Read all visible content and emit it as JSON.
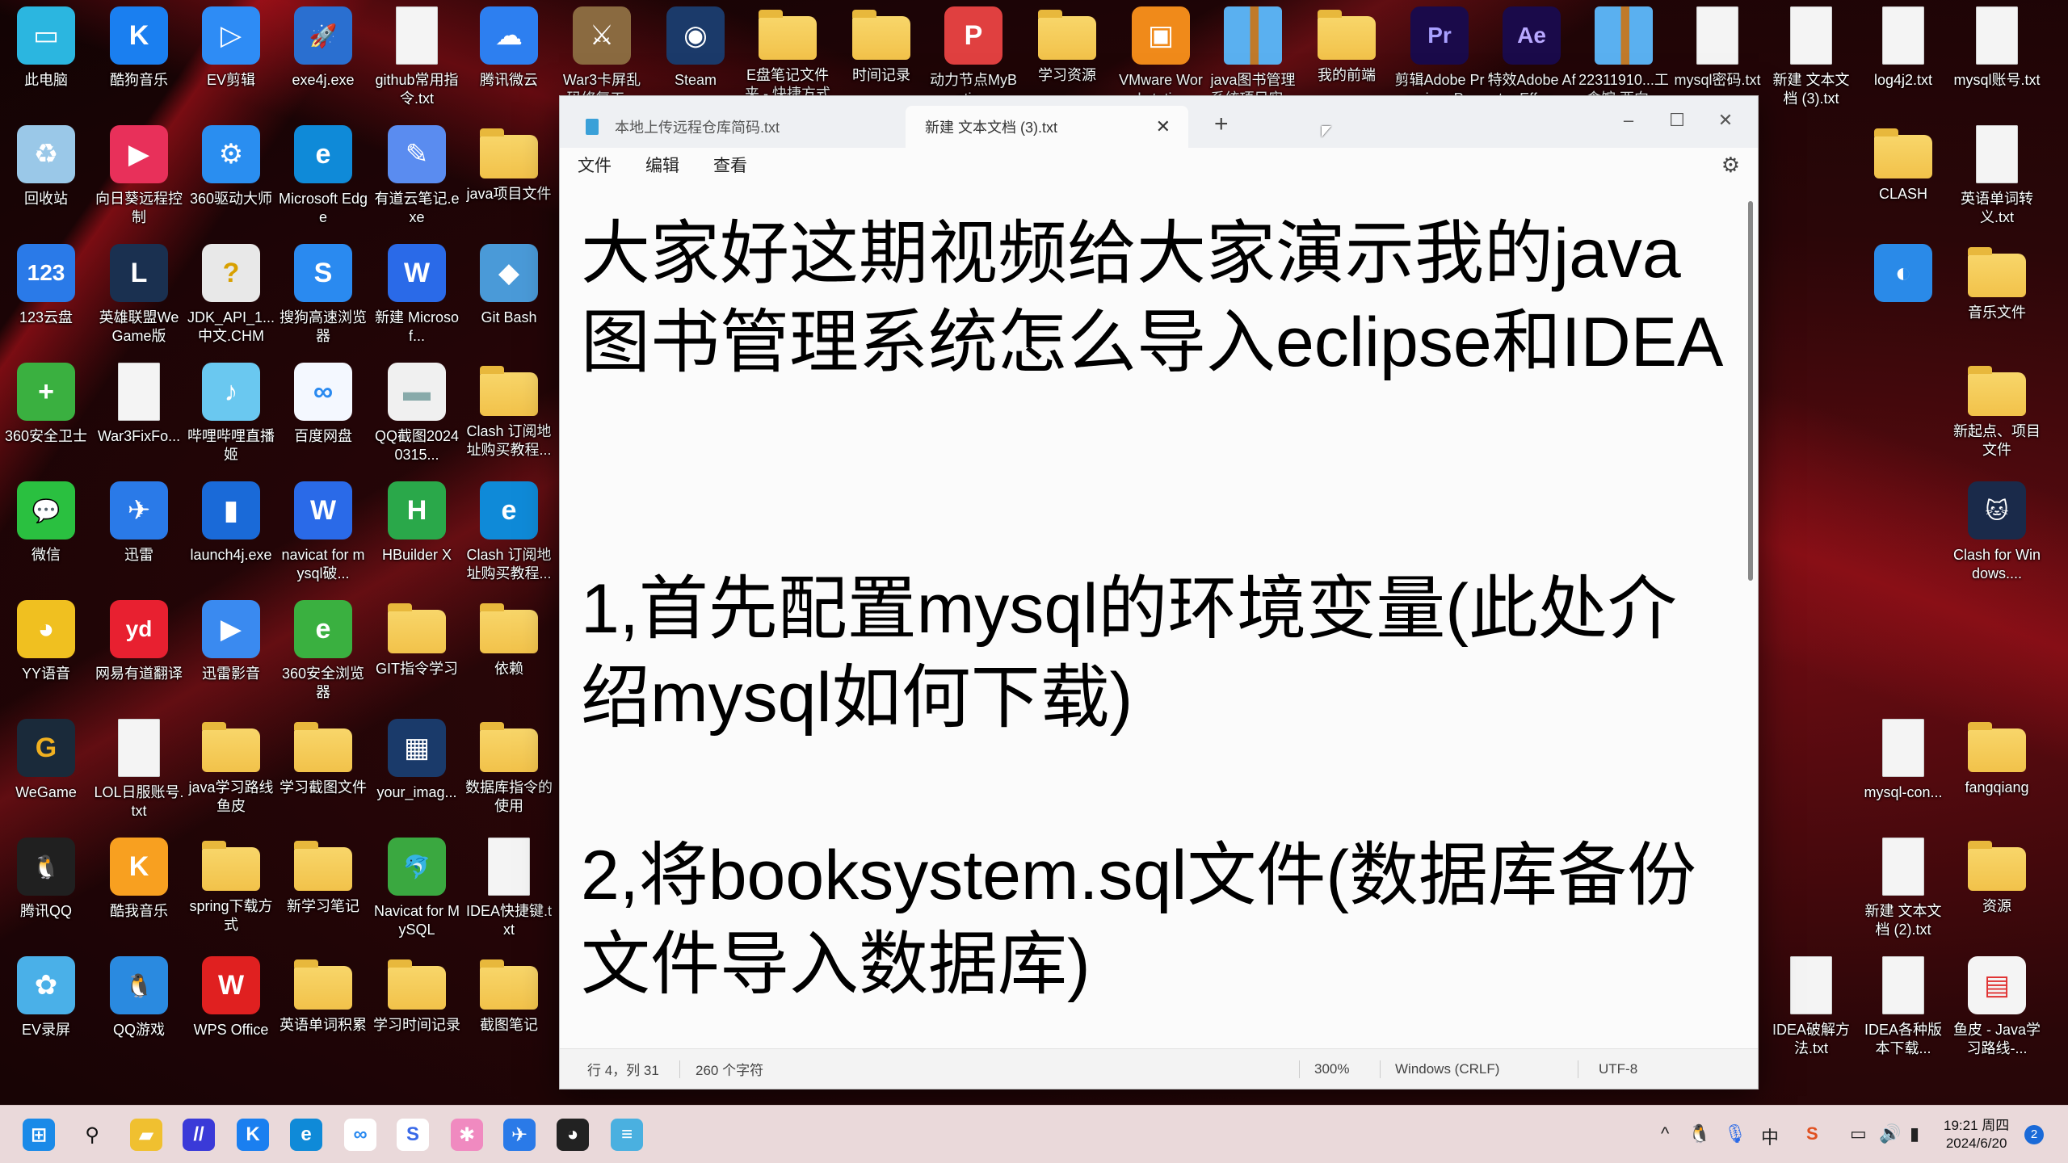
{
  "desktop": {
    "icons": [
      {
        "label": "此电脑",
        "icon": "computer-icon",
        "kind": "app",
        "color": "#2bb6e0",
        "glyph": "▭"
      },
      {
        "label": "酷狗音乐",
        "icon": "kugou-icon",
        "kind": "app",
        "color": "#1a7ff0",
        "glyph": "K"
      },
      {
        "label": "EV剪辑",
        "icon": "ev-edit-icon",
        "kind": "app",
        "color": "#2e8cf5",
        "glyph": "▷"
      },
      {
        "label": "exe4j.exe",
        "icon": "rocket-icon",
        "kind": "app",
        "color": "#2a6fd0",
        "glyph": "🚀"
      },
      {
        "label": "github常用指令.txt",
        "icon": "text-file-icon",
        "kind": "txt"
      },
      {
        "label": "腾讯微云",
        "icon": "weiyun-icon",
        "kind": "app",
        "color": "#2d7ff0",
        "glyph": "☁"
      },
      {
        "label": "War3卡屏乱码修复工...",
        "icon": "war3-icon",
        "kind": "app",
        "color": "#8a6a40",
        "glyph": "⚔"
      },
      {
        "label": "Steam",
        "icon": "steam-icon",
        "kind": "app",
        "color": "#1b3a6a",
        "glyph": "◉"
      },
      {
        "label": "E盘笔记文件夹 - 快捷方式",
        "icon": "folder-icon",
        "kind": "folder"
      },
      {
        "label": "时间记录",
        "icon": "folder-icon",
        "kind": "folder"
      },
      {
        "label": "动力节点MyBatis...",
        "icon": "pdf-icon",
        "kind": "app",
        "color": "#e04040",
        "glyph": "P"
      },
      {
        "label": "学习资源",
        "icon": "folder-icon",
        "kind": "folder"
      },
      {
        "label": "VMware Workstati...",
        "icon": "vmware-icon",
        "kind": "app",
        "color": "#f08a1a",
        "glyph": "▣"
      },
      {
        "label": "java图书管理系统项目实...",
        "icon": "zip-icon",
        "kind": "zip"
      },
      {
        "label": "我的前端",
        "icon": "folder-icon",
        "kind": "folder"
      },
      {
        "label": "剪辑Adobe Premiere P...",
        "icon": "premiere-icon",
        "kind": "app",
        "color": "#1a0a4a",
        "glyph": "Pr",
        "fg": "#a9a0ff"
      },
      {
        "label": "特效Adobe After Effec...",
        "icon": "after-effects-icon",
        "kind": "app",
        "color": "#1a0a4a",
        "glyph": "Ae",
        "fg": "#b8a8ff"
      },
      {
        "label": "22311910...工食馆 西向...",
        "icon": "zip-icon",
        "kind": "zip"
      },
      {
        "label": "mysql密码.txt",
        "icon": "text-file-icon",
        "kind": "txt"
      },
      {
        "label": "新建 文本文档 (3).txt",
        "icon": "text-file-icon",
        "kind": "txt"
      },
      {
        "label": "log4j2.txt",
        "icon": "text-file-icon",
        "kind": "txt"
      },
      {
        "label": "mysql账号.txt",
        "icon": "text-file-icon",
        "kind": "txt"
      },
      {
        "label": "回收站",
        "icon": "recycle-bin-icon",
        "kind": "app",
        "color": "#9ac8e8",
        "glyph": "♻"
      },
      {
        "label": "向日葵远程控制",
        "icon": "sunlogin-icon",
        "kind": "app",
        "color": "#e8305a",
        "glyph": "▶"
      },
      {
        "label": "360驱动大师",
        "icon": "driver-icon",
        "kind": "app",
        "color": "#2a8ef0",
        "glyph": "⚙"
      },
      {
        "label": "Microsoft Edge",
        "icon": "edge-icon",
        "kind": "app",
        "color": "#0f8ad8",
        "glyph": "e"
      },
      {
        "label": "有道云笔记.exe",
        "icon": "youdao-note-icon",
        "kind": "app",
        "color": "#5a8cf0",
        "glyph": "✎"
      },
      {
        "label": "java项目文件",
        "icon": "folder-icon",
        "kind": "folder"
      },
      {
        "label": "123云盘",
        "icon": "123pan-icon",
        "kind": "app",
        "color": "#2a7ae8",
        "glyph": "123"
      },
      {
        "label": "英雄联盟WeGame版",
        "icon": "lol-icon",
        "kind": "app",
        "color": "#1a3050",
        "glyph": "L"
      },
      {
        "label": "JDK_API_1...中文.CHM",
        "icon": "chm-icon",
        "kind": "app",
        "color": "#e8e8e8",
        "glyph": "?",
        "fg": "#d8a000"
      },
      {
        "label": "搜狗高速浏览器",
        "icon": "sogou-browser-icon",
        "kind": "app",
        "color": "#2a8af0",
        "glyph": "S"
      },
      {
        "label": "新建 Microsof...",
        "icon": "word-doc-icon",
        "kind": "app",
        "color": "#2a6ae8",
        "glyph": "W"
      },
      {
        "label": "Git Bash",
        "icon": "git-icon",
        "kind": "app",
        "color": "#4a9ad8",
        "glyph": "◆"
      },
      {
        "label": "360安全卫士",
        "icon": "360-icon",
        "kind": "app",
        "color": "#3ab040",
        "glyph": "+"
      },
      {
        "label": "War3FixFo...",
        "icon": "json-file-icon",
        "kind": "txt"
      },
      {
        "label": "哔哩哔哩直播姬",
        "icon": "bilibili-live-icon",
        "kind": "app",
        "color": "#6ac8f0",
        "glyph": "♪"
      },
      {
        "label": "百度网盘",
        "icon": "baidu-pan-icon",
        "kind": "app",
        "color": "#f4f8ff",
        "glyph": "∞",
        "fg": "#2a8af0"
      },
      {
        "label": "QQ截图20240315...",
        "icon": "image-icon",
        "kind": "app",
        "color": "#f0f0f0",
        "glyph": "▬",
        "fg": "#8aa"
      },
      {
        "label": "Clash 订阅地址购买教程...",
        "icon": "folder-icon",
        "kind": "folder"
      },
      {
        "label": "微信",
        "icon": "wechat-icon",
        "kind": "app",
        "color": "#2ac040",
        "glyph": "💬"
      },
      {
        "label": "迅雷",
        "icon": "xunlei-icon",
        "kind": "app",
        "color": "#2a7ae8",
        "glyph": "✈"
      },
      {
        "label": "launch4j.exe",
        "icon": "launch4j-icon",
        "kind": "app",
        "color": "#1a6ad8",
        "glyph": "▮"
      },
      {
        "label": "navicat for mysql破...",
        "icon": "word-doc-icon",
        "kind": "app",
        "color": "#2a6ae8",
        "glyph": "W"
      },
      {
        "label": "HBuilder X",
        "icon": "hbuilder-icon",
        "kind": "app",
        "color": "#2aa84a",
        "glyph": "H"
      },
      {
        "label": "Clash 订阅地址购买教程...",
        "icon": "edge-icon",
        "kind": "app",
        "color": "#0f8ad8",
        "glyph": "e"
      },
      {
        "label": "YY语音",
        "icon": "yy-icon",
        "kind": "app",
        "color": "#f0c020",
        "glyph": "◕"
      },
      {
        "label": "网易有道翻译",
        "icon": "youdao-icon",
        "kind": "app",
        "color": "#e82030",
        "glyph": "yd"
      },
      {
        "label": "迅雷影音",
        "icon": "xunlei-player-icon",
        "kind": "app",
        "color": "#3a8af0",
        "glyph": "▶"
      },
      {
        "label": "360安全浏览器",
        "icon": "360-browser-icon",
        "kind": "app",
        "color": "#3ab040",
        "glyph": "e"
      },
      {
        "label": "GIT指令学习",
        "icon": "folder-icon",
        "kind": "folder"
      },
      {
        "label": "依赖",
        "icon": "folder-icon",
        "kind": "folder"
      },
      {
        "label": "WeGame",
        "icon": "wegame-icon",
        "kind": "app",
        "color": "#1a2a3a",
        "glyph": "G",
        "fg": "#f0b020"
      },
      {
        "label": "LOL日服账号.txt",
        "icon": "text-file-icon",
        "kind": "txt"
      },
      {
        "label": "java学习路线鱼皮",
        "icon": "folder-icon",
        "kind": "folder"
      },
      {
        "label": "学习截图文件",
        "icon": "folder-icon",
        "kind": "folder"
      },
      {
        "label": "your_imag...",
        "icon": "image-icon",
        "kind": "app",
        "color": "#1a3a6a",
        "glyph": "▦"
      },
      {
        "label": "数据库指令的使用",
        "icon": "folder-icon",
        "kind": "folder"
      },
      {
        "label": "腾讯QQ",
        "icon": "qq-icon",
        "kind": "app",
        "color": "#202020",
        "glyph": "🐧"
      },
      {
        "label": "酷我音乐",
        "icon": "kuwo-icon",
        "kind": "app",
        "color": "#f8a020",
        "glyph": "K"
      },
      {
        "label": "spring下载方式",
        "icon": "folder-icon",
        "kind": "folder"
      },
      {
        "label": "新学习笔记",
        "icon": "folder-icon",
        "kind": "folder"
      },
      {
        "label": "Navicat for MySQL",
        "icon": "navicat-icon",
        "kind": "app",
        "color": "#3aa840",
        "glyph": "🐬"
      },
      {
        "label": "IDEA快捷键.txt",
        "icon": "text-file-icon",
        "kind": "txt"
      },
      {
        "label": "EV录屏",
        "icon": "ev-record-icon",
        "kind": "app",
        "color": "#4ab0e8",
        "glyph": "✿"
      },
      {
        "label": "QQ游戏",
        "icon": "qq-game-icon",
        "kind": "app",
        "color": "#2a8ae0",
        "glyph": "🐧"
      },
      {
        "label": "WPS Office",
        "icon": "wps-icon",
        "kind": "app",
        "color": "#e02020",
        "glyph": "W"
      },
      {
        "label": "英语单词积累",
        "icon": "folder-icon",
        "kind": "folder"
      },
      {
        "label": "学习时间记录",
        "icon": "folder-icon",
        "kind": "folder"
      },
      {
        "label": "截图笔记",
        "icon": "folder-icon",
        "kind": "folder"
      },
      {
        "label": "CLASH",
        "icon": "folder-icon",
        "kind": "folder"
      },
      {
        "label": "英语单词转义.txt",
        "icon": "text-file-icon",
        "kind": "txt"
      },
      {
        "label": "",
        "icon": "globe-icon",
        "kind": "app",
        "color": "#2a8ae8",
        "glyph": "◐"
      },
      {
        "label": "音乐文件",
        "icon": "folder-icon",
        "kind": "folder"
      },
      {
        "label": "新起点、项目文件",
        "icon": "folder-icon",
        "kind": "folder"
      },
      {
        "label": "Clash for Windows....",
        "icon": "clash-icon",
        "kind": "app",
        "color": "#1a2a4a",
        "glyph": "🐱"
      },
      {
        "label": "mysql-con...",
        "icon": "text-file-icon",
        "kind": "txt"
      },
      {
        "label": "fangqiang",
        "icon": "folder-icon",
        "kind": "folder"
      },
      {
        "label": "新建 文本文档 (2).txt",
        "icon": "text-file-icon",
        "kind": "txt"
      },
      {
        "label": "资源",
        "icon": "folder-icon",
        "kind": "folder"
      },
      {
        "label": "IDEA破解方法.txt",
        "icon": "text-file-icon",
        "kind": "txt"
      },
      {
        "label": "IDEA各种版本下载...",
        "icon": "text-file-icon",
        "kind": "txt"
      },
      {
        "label": "鱼皮 - Java学习路线-...",
        "icon": "image-icon",
        "kind": "app",
        "color": "#f4f4f4",
        "glyph": "▤",
        "fg": "#e03030"
      }
    ]
  },
  "notepad": {
    "tabs": [
      {
        "label": "本地上传远程仓库简码.txt"
      },
      {
        "label": "新建 文本文档 (3).txt"
      }
    ],
    "new_tab": "+",
    "menu": [
      "文件",
      "编辑",
      "查看"
    ],
    "content": "大家好这期视频给大家演示我的java图书管理系统怎么导入eclipse和IDEA\n\n\n1,首先配置mysql的环境变量(此处介绍mysql如何下载)\n\n2,将booksystem.sql文件(数据库备份文件导入数据库)",
    "status": {
      "position": "行 4，列 31",
      "chars": "260 个字符",
      "zoom": "300%",
      "line_ending": "Windows (CRLF)",
      "encoding": "UTF-8"
    }
  },
  "taskbar": {
    "apps": [
      {
        "icon": "start-icon",
        "color": "#1a8ae8",
        "glyph": "⊞"
      },
      {
        "icon": "search-icon",
        "color": "transparent",
        "glyph": "⚲",
        "fg": "#111"
      },
      {
        "icon": "file-explorer-icon",
        "color": "#f0c030",
        "glyph": "▰"
      },
      {
        "icon": "app-icon",
        "color": "#3a3ad8",
        "glyph": "//"
      },
      {
        "icon": "kugou-icon",
        "color": "#1a7ff0",
        "glyph": "K"
      },
      {
        "icon": "edge-icon",
        "color": "#0f8ad8",
        "glyph": "e"
      },
      {
        "icon": "baidu-pan-icon",
        "color": "#fff",
        "glyph": "∞",
        "fg": "#2a8af0"
      },
      {
        "icon": "sogou-browser-icon",
        "color": "#fff",
        "glyph": "S",
        "fg": "#3a6ae8"
      },
      {
        "icon": "colorful-app-icon",
        "color": "#f08ac0",
        "glyph": "✱"
      },
      {
        "icon": "xunlei-icon",
        "color": "#2a7ae8",
        "glyph": "✈"
      },
      {
        "icon": "avatar-app-icon",
        "color": "#222",
        "glyph": "◕"
      },
      {
        "icon": "notepad-icon",
        "color": "#4ab0e0",
        "glyph": "≡"
      }
    ],
    "tray": {
      "overflow": "^",
      "ime": "中",
      "time": "19:21 周四",
      "date": "2024/6/20",
      "notifications": "2"
    }
  }
}
